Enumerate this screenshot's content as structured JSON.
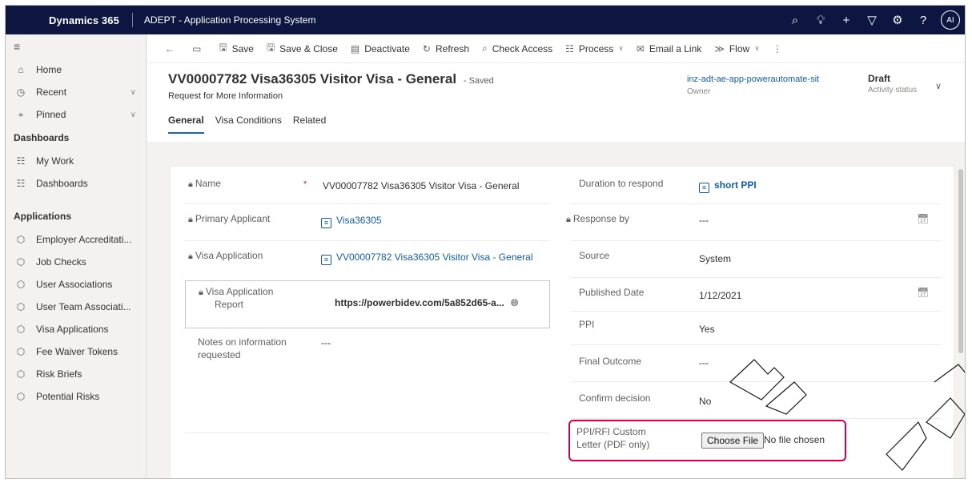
{
  "topbar": {
    "brand": "Dynamics 365",
    "app_title": "ADEPT - Application Processing System",
    "avatar_initials": "AI"
  },
  "sidebar": {
    "top_items": [
      {
        "label": "Home",
        "icon": "home-icon"
      },
      {
        "label": "Recent",
        "icon": "clock-icon"
      },
      {
        "label": "Pinned",
        "icon": "pin-icon"
      }
    ],
    "dashboards_header": "Dashboards",
    "dashboards": [
      {
        "label": "My Work",
        "icon": "grid-icon"
      },
      {
        "label": "Dashboards",
        "icon": "grid-icon"
      }
    ],
    "applications_header": "Applications",
    "applications": [
      {
        "label": "Employer Accreditati..."
      },
      {
        "label": "Job Checks"
      },
      {
        "label": "User Associations"
      },
      {
        "label": "User Team Associati..."
      },
      {
        "label": "Visa Applications"
      },
      {
        "label": "Fee Waiver Tokens"
      },
      {
        "label": "Risk Briefs"
      },
      {
        "label": "Potential Risks"
      }
    ]
  },
  "commands": {
    "save": "Save",
    "save_close": "Save & Close",
    "deactivate": "Deactivate",
    "refresh": "Refresh",
    "check_access": "Check Access",
    "process": "Process",
    "email_link": "Email a Link",
    "flow": "Flow"
  },
  "record": {
    "title": "VV00007782 Visa36305 Visitor Visa - General",
    "saved_status": "- Saved",
    "entity": "Request for More Information",
    "owner": "inz-adt-ae-app-powerautomate-sit",
    "owner_label": "Owner",
    "status": "Draft",
    "status_label": "Activity status"
  },
  "tabs": [
    "General",
    "Visa Conditions",
    "Related"
  ],
  "left_fields": {
    "name_label": "Name",
    "name_value": "VV00007782 Visa36305 Visitor Visa - General",
    "primary_applicant_label": "Primary Applicant",
    "primary_applicant_value": "Visa36305",
    "visa_application_label": "Visa Application",
    "visa_application_value": "VV00007782 Visa36305 Visitor Visa - General",
    "report_label_1": "Visa Application",
    "report_label_2": "Report",
    "report_value": "https://powerbidev.com/5a852d65-a...",
    "notes_label_1": "Notes on information",
    "notes_label_2": "requested",
    "notes_value": "---"
  },
  "right_fields": {
    "duration_label": "Duration to respond",
    "duration_value": "short PPI",
    "response_label": "Response by",
    "response_value": "---",
    "source_label": "Source",
    "source_value": "System",
    "published_label": "Published Date",
    "published_value": "1/12/2021",
    "ppi_label": "PPI",
    "ppi_value": "Yes",
    "final_outcome_label": "Final Outcome",
    "final_outcome_value": "---",
    "confirm_label": "Confirm decision",
    "confirm_value": "No",
    "letter_label_1": "PPI/RFI Custom",
    "letter_label_2": "Letter (PDF only)",
    "choose_file": "Choose File",
    "no_file": "No file chosen"
  },
  "colors": {
    "topbar_bg": "#0d1640",
    "link": "#115ea3",
    "highlight_border": "#d2004c",
    "tab_underline": "#0f6cbd"
  }
}
